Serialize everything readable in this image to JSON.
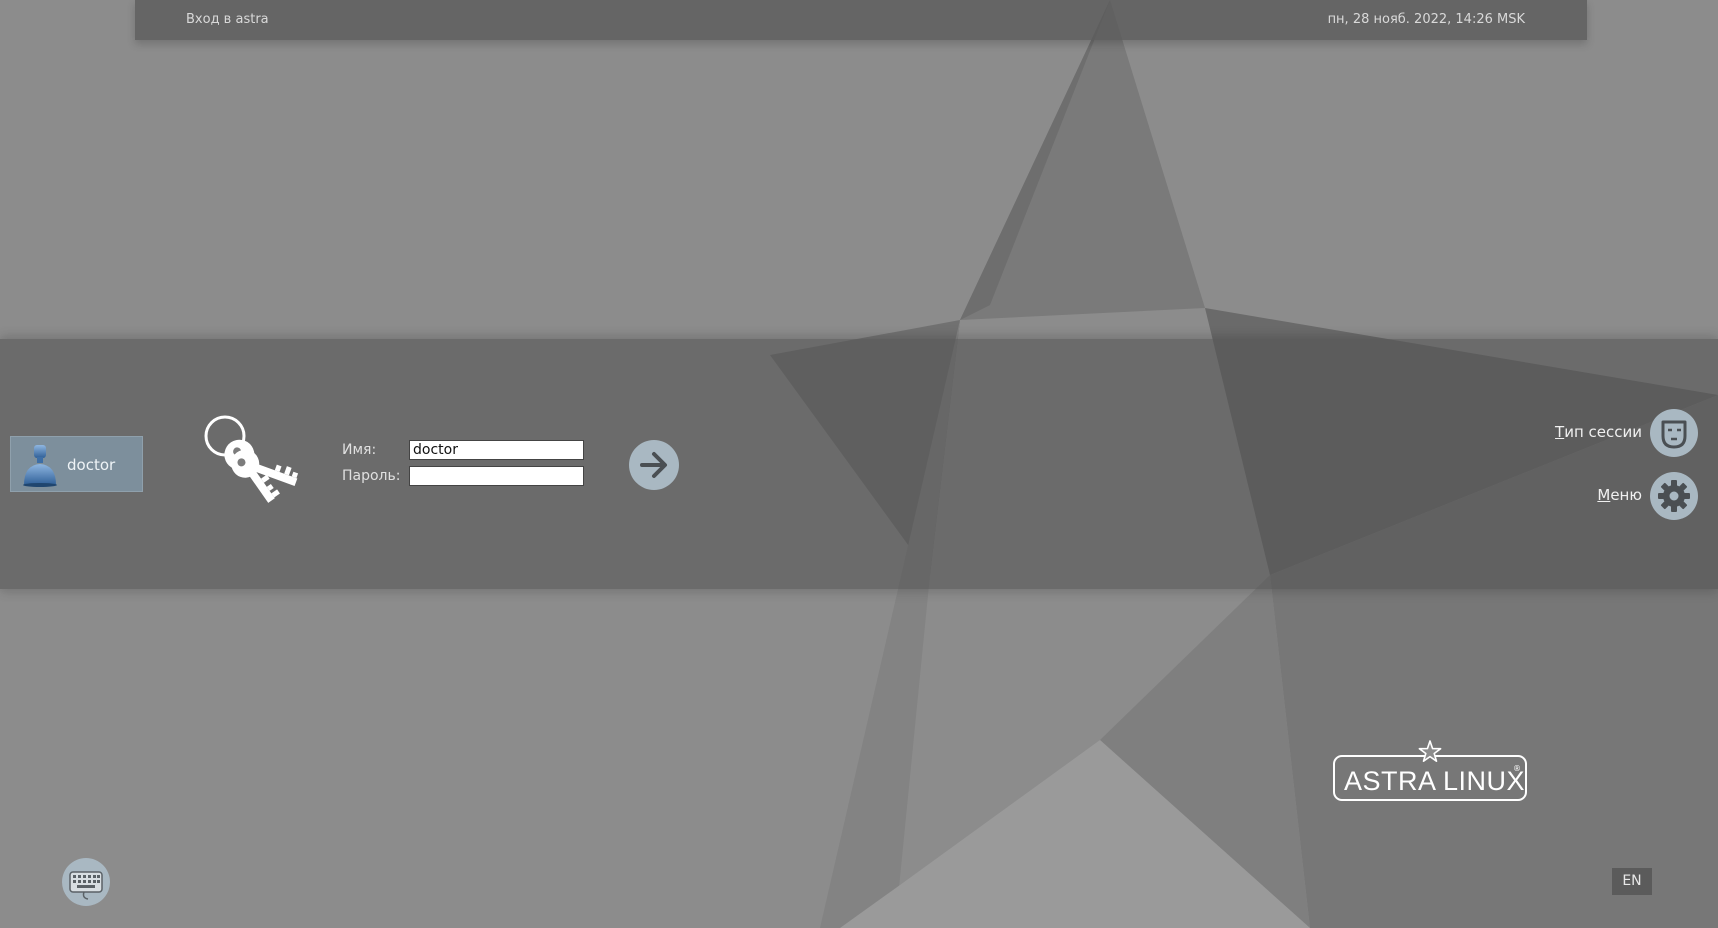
{
  "topbar": {
    "title": "Вход в astra",
    "datetime": "пн, 28 нояб. 2022, 14:26 MSK"
  },
  "users": [
    {
      "name": "doctor",
      "icon": "user-avatar-icon",
      "selected": true
    }
  ],
  "login": {
    "name_label": "Имя:",
    "name_value": "doctor",
    "password_label": "Пароль:",
    "password_value": "",
    "keys_icon": "keys-icon",
    "submit_icon": "arrow-right-icon"
  },
  "side": {
    "session_type": {
      "accel": "Т",
      "rest": "ип сессии",
      "icon": "mask-icon"
    },
    "menu": {
      "accel": "М",
      "rest": "еню",
      "icon": "gear-icon"
    }
  },
  "logo": {
    "text": "ASTRA LINUX",
    "reg": "®"
  },
  "bottom": {
    "keyboard_icon": "keyboard-icon",
    "language": "EN"
  },
  "colors": {
    "background": "#8c8c8c",
    "topbar": "#5a5a5a",
    "accent_circle": "#a9b8c2",
    "user_selected": "#7d8f9c"
  }
}
